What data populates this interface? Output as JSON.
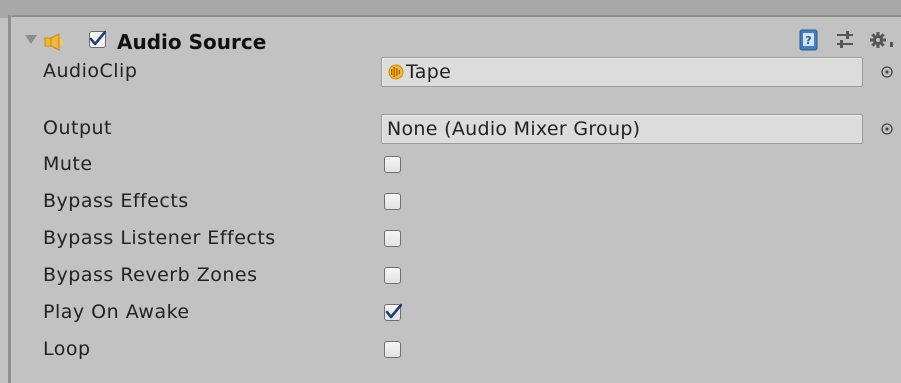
{
  "component": {
    "title": "Audio Source",
    "enabled": true,
    "expanded": true
  },
  "fields": {
    "audio_clip": {
      "label": "AudioClip",
      "value": "Tape"
    },
    "output": {
      "label": "Output",
      "value": "None (Audio Mixer Group)"
    }
  },
  "toggles": [
    {
      "label": "Mute",
      "checked": false
    },
    {
      "label": "Bypass Effects",
      "checked": false
    },
    {
      "label": "Bypass Listener Effects",
      "checked": false
    },
    {
      "label": "Bypass Reverb Zones",
      "checked": false
    },
    {
      "label": "Play On Awake",
      "checked": true
    },
    {
      "label": "Loop",
      "checked": false
    }
  ],
  "icons": {
    "foldout": "triangle-down-icon",
    "component": "speaker-icon",
    "clip": "audio-clip-icon",
    "help": "help-book-icon",
    "preset": "preset-sliders-icon",
    "settings": "gear-icon",
    "picker": "object-picker-icon"
  },
  "colors": {
    "panel_bg": "#c2c2c2",
    "field_bg": "#dcdcdc",
    "speaker": "#f2b632",
    "check": "#1f3f7a"
  }
}
